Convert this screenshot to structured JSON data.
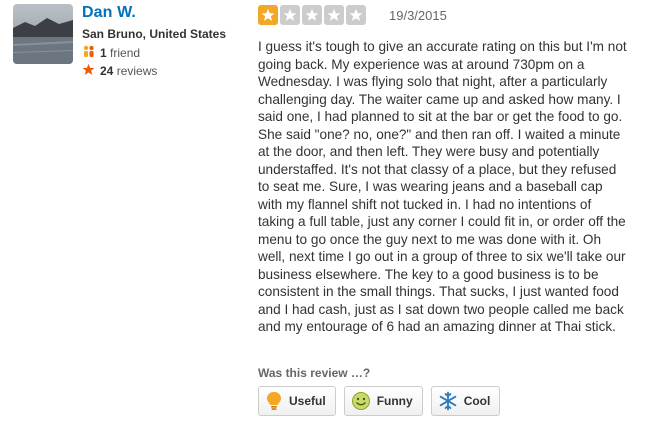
{
  "user": {
    "name": "Dan W.",
    "location": "San Bruno, United States",
    "friends_count": "1",
    "friends_label": "friend",
    "reviews_count": "24",
    "reviews_label": "reviews"
  },
  "review": {
    "rating": 1,
    "max_rating": 5,
    "date": "19/3/2015",
    "text": "I guess it's tough to give an accurate rating on this but I'm not going back. My experience was at around 730pm on a Wednesday. I was flying solo that night, after a particularly challenging day. The waiter came up and asked how many. I said one, I had planned to sit at the bar or get the food to go. She said \"one? no, one?\" and then ran off. I waited a minute at the door, and then left. They were busy and potentially understaffed. It's not that classy of a place, but they refused to seat me. Sure, I was wearing jeans and a baseball cap with my flannel shift not tucked in. I had no intentions of taking a full table, just any corner I could fit in, or order off the menu to go once the guy next to me was done with it. Oh well, next time I go out in a group of three to six we'll take our business elsewhere. The key to a good business is to be consistent in the small things. That sucks, I just wanted food and I had cash, just as I sat down two people called me back and my entourage of 6 had an amazing dinner at Thai stick."
  },
  "votes": {
    "prompt": "Was this review …?",
    "useful_label": "Useful",
    "funny_label": "Funny",
    "cool_label": "Cool"
  },
  "colors": {
    "name_link": "#0073bb",
    "star_on": "#f0a826",
    "star_off": "#cccccc",
    "friends_icon": "#f5a623",
    "reviews_icon": "#f15c00"
  },
  "icons": {
    "friends": "friends-icon",
    "reviews": "star-icon",
    "useful": "lightbulb-icon",
    "funny": "smiley-icon",
    "cool": "snowflake-icon"
  }
}
